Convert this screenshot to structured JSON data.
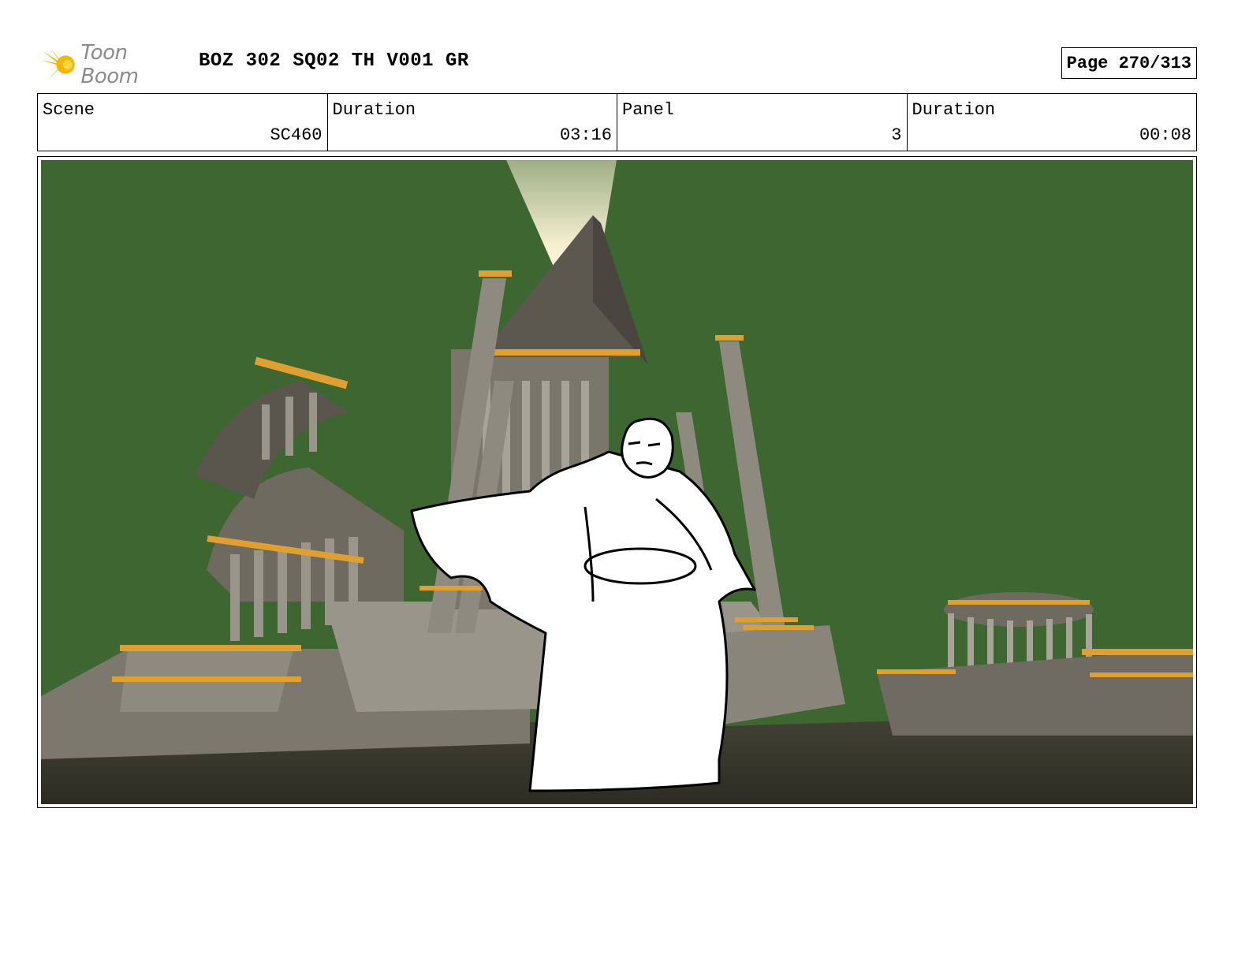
{
  "header": {
    "logo_text": "Toon Boom",
    "title": "BOZ 302 SQ02 TH V001 GR",
    "page": "Page 270/313"
  },
  "info": {
    "scene_label": "Scene",
    "scene_value": "SC460",
    "scene_duration_label": "Duration",
    "scene_duration_value": "03:16",
    "panel_label": "Panel",
    "panel_value": "3",
    "panel_duration_label": "Duration",
    "panel_duration_value": "00:08"
  },
  "panel": {
    "sky_color": "#3d6630",
    "stone_color": "#8f8a80",
    "gold_color": "#e0a030"
  }
}
